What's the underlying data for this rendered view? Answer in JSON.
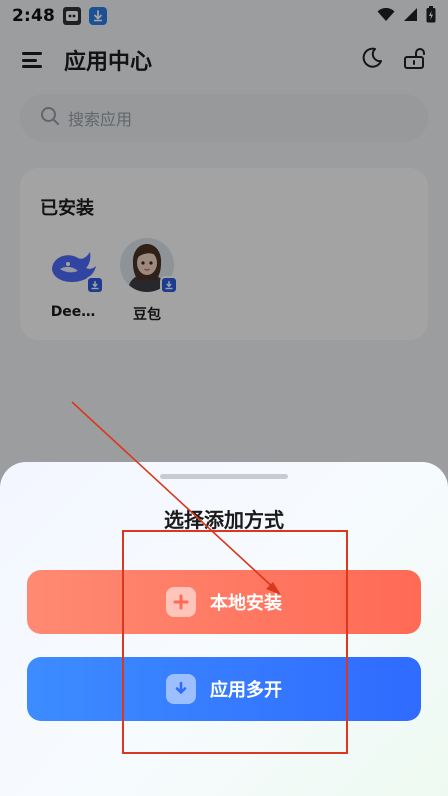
{
  "status_bar": {
    "time": "2:48"
  },
  "header": {
    "title": "应用中心"
  },
  "search": {
    "placeholder": "搜索应用"
  },
  "installed": {
    "title": "已安装",
    "apps": [
      {
        "name": "Dee…",
        "icon": "deepseek-whale-icon"
      },
      {
        "name": "豆包",
        "icon": "doubao-avatar-icon"
      }
    ]
  },
  "sheet": {
    "title": "选择添加方式",
    "local_install": {
      "label": "本地安装",
      "icon": "plus-icon"
    },
    "app_multi": {
      "label": "应用多开",
      "icon": "download-arrow-icon"
    }
  },
  "colors": {
    "local_button": "#ff7560",
    "multi_button": "#3478ff",
    "annotation": "#d9381e"
  }
}
